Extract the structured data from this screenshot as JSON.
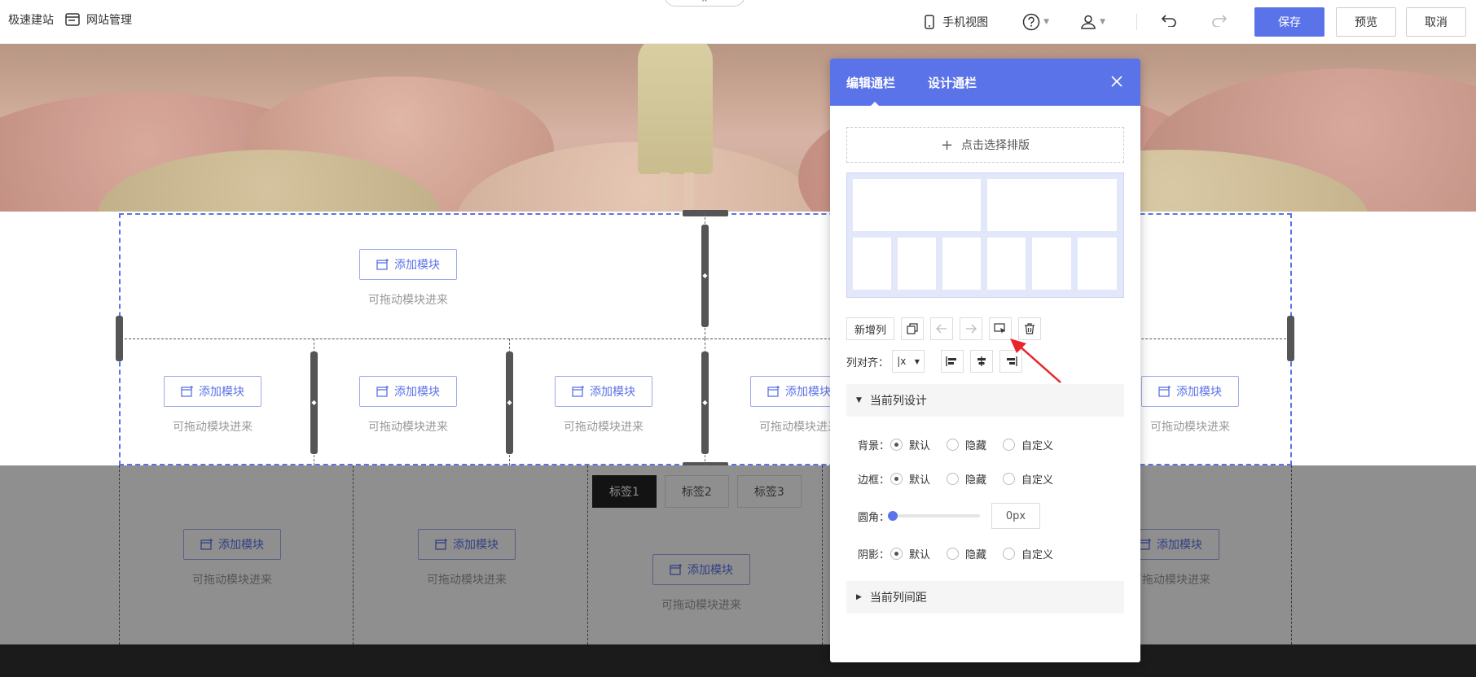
{
  "topbar": {
    "site_label": "极速建站",
    "manage_label": "网站管理",
    "mobile_view_label": "手机视图",
    "save_label": "保存",
    "preview_label": "预览",
    "cancel_label": "取消",
    "notch_icon": "×"
  },
  "module": {
    "add_label": "添加模块",
    "drag_tip": "可拖动模块进来"
  },
  "tabs": [
    "标签1",
    "标签2",
    "标签3"
  ],
  "panel": {
    "tab_edit": "编辑通栏",
    "tab_design": "设计通栏",
    "choose_layout": "点击选择排版",
    "add_column": "新增列",
    "col_align_label": "列对齐：",
    "current_col_design": "当前列设计",
    "background_label": "背景：",
    "border_label": "边框：",
    "radius_label": "圆角：",
    "shadow_label": "阴影：",
    "opt_default": "默认",
    "opt_hidden": "隐藏",
    "opt_custom": "自定义",
    "radius_value": "0px",
    "radius_percent": 0,
    "current_col_spacing": "当前列间距",
    "align_icon": "|x"
  },
  "colors": {
    "accent": "#5b73e8",
    "arrow": "#e8262c"
  }
}
